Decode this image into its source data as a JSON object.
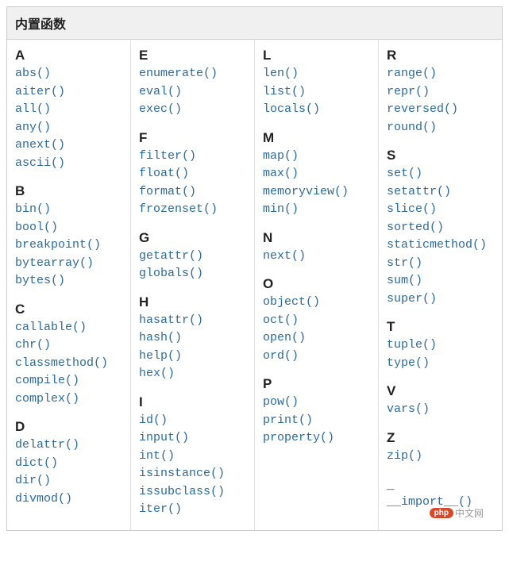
{
  "title": "内置函数",
  "columns": [
    [
      {
        "letter": "A",
        "items": [
          "abs()",
          "aiter()",
          "all()",
          "any()",
          "anext()",
          "ascii()"
        ]
      },
      {
        "letter": "B",
        "items": [
          "bin()",
          "bool()",
          "breakpoint()",
          "bytearray()",
          "bytes()"
        ]
      },
      {
        "letter": "C",
        "items": [
          "callable()",
          "chr()",
          "classmethod()",
          "compile()",
          "complex()"
        ]
      },
      {
        "letter": "D",
        "items": [
          "delattr()",
          "dict()",
          "dir()",
          "divmod()"
        ]
      }
    ],
    [
      {
        "letter": "E",
        "items": [
          "enumerate()",
          "eval()",
          "exec()"
        ]
      },
      {
        "letter": "F",
        "items": [
          "filter()",
          "float()",
          "format()",
          "frozenset()"
        ]
      },
      {
        "letter": "G",
        "items": [
          "getattr()",
          "globals()"
        ]
      },
      {
        "letter": "H",
        "items": [
          "hasattr()",
          "hash()",
          "help()",
          "hex()"
        ]
      },
      {
        "letter": "I",
        "items": [
          "id()",
          "input()",
          "int()",
          "isinstance()",
          "issubclass()",
          "iter()"
        ]
      }
    ],
    [
      {
        "letter": "L",
        "items": [
          "len()",
          "list()",
          "locals()"
        ]
      },
      {
        "letter": "M",
        "items": [
          "map()",
          "max()",
          "memoryview()",
          "min()"
        ]
      },
      {
        "letter": "N",
        "items": [
          "next()"
        ]
      },
      {
        "letter": "O",
        "items": [
          "object()",
          "oct()",
          "open()",
          "ord()"
        ]
      },
      {
        "letter": "P",
        "items": [
          "pow()",
          "print()",
          "property()"
        ]
      }
    ],
    [
      {
        "letter": "R",
        "items": [
          "range()",
          "repr()",
          "reversed()",
          "round()"
        ]
      },
      {
        "letter": "S",
        "items": [
          "set()",
          "setattr()",
          "slice()",
          "sorted()",
          "staticmethod()",
          "str()",
          "sum()",
          "super()"
        ]
      },
      {
        "letter": "T",
        "items": [
          "tuple()",
          "type()"
        ]
      },
      {
        "letter": "V",
        "items": [
          "vars()"
        ]
      },
      {
        "letter": "Z",
        "items": [
          "zip()"
        ]
      },
      {
        "letter": "_",
        "items": [
          "__import__()"
        ]
      }
    ]
  ],
  "watermark": {
    "badge": "php",
    "text": "中文网"
  }
}
